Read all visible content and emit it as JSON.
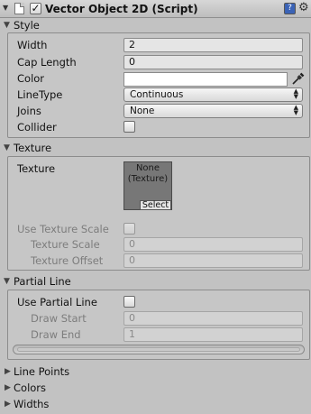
{
  "header": {
    "title": "Vector Object 2D (Script)",
    "enabled": true
  },
  "style": {
    "section_label": "Style",
    "width_label": "Width",
    "width_value": "2",
    "cap_length_label": "Cap Length",
    "cap_length_value": "0",
    "color_label": "Color",
    "color_value": "#ffffff",
    "linetype_label": "LineType",
    "linetype_value": "Continuous",
    "joins_label": "Joins",
    "joins_value": "None",
    "collider_label": "Collider"
  },
  "texture": {
    "section_label": "Texture",
    "texture_label": "Texture",
    "texture_none_line1": "None",
    "texture_none_line2": "(Texture)",
    "select_label": "Select",
    "use_texture_scale_label": "Use Texture Scale",
    "texture_scale_label": "Texture Scale",
    "texture_scale_value": "0",
    "texture_offset_label": "Texture Offset",
    "texture_offset_value": "0"
  },
  "partial_line": {
    "section_label": "Partial Line",
    "use_partial_line_label": "Use Partial Line",
    "draw_start_label": "Draw Start",
    "draw_start_value": "0",
    "draw_end_label": "Draw End",
    "draw_end_value": "1"
  },
  "collapsed_sections": {
    "line_points": "Line Points",
    "colors": "Colors",
    "widths": "Widths"
  },
  "icons": {
    "header_fold": "triangle-down-icon",
    "script_icon": "document-icon",
    "help_icon": "help-book-icon",
    "settings_icon": "gear-icon",
    "eyedropper": "eyedropper-icon"
  }
}
